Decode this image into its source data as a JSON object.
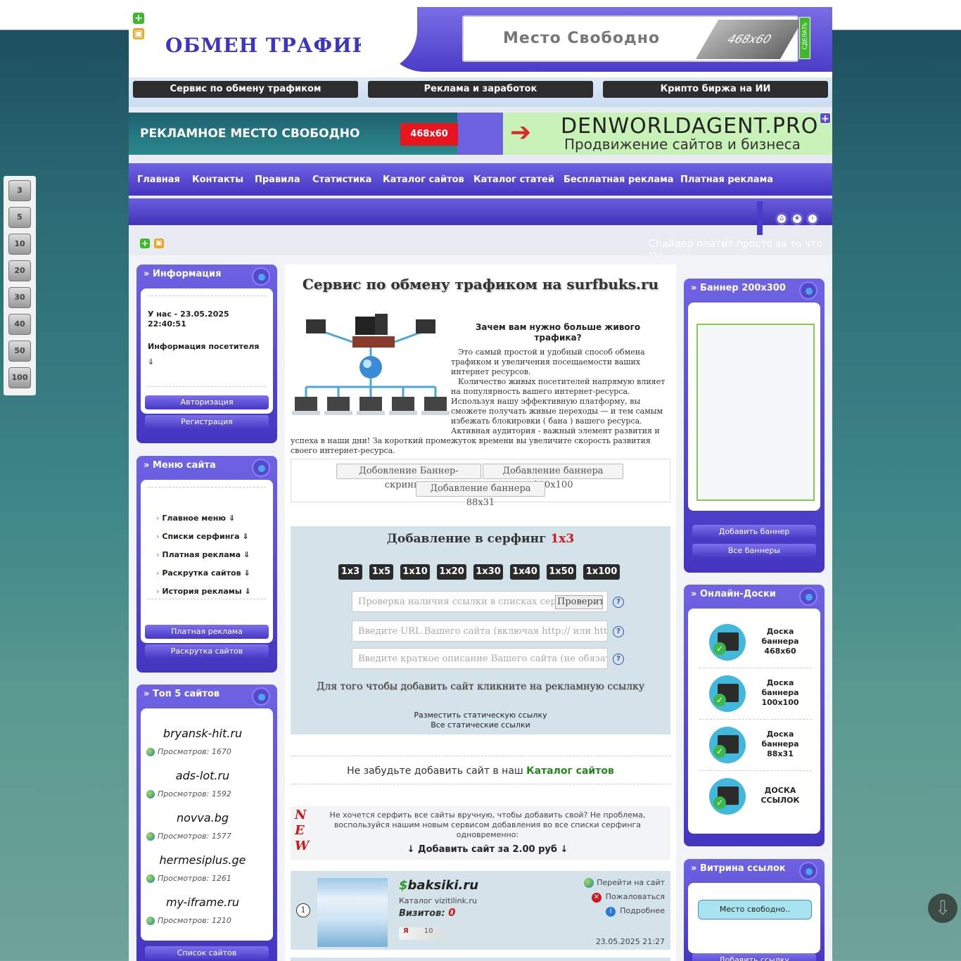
{
  "header": {
    "logo": "ОБМЕН ТРАФИКОМ",
    "top_banner_text": "Место  Свободно",
    "top_banner_size": "468x60",
    "side_tag": "СДЕЛАТЬ"
  },
  "nav_buttons": [
    "Сервис по обмену трафиком",
    "Реклама и заработок",
    "Крипто биржа на ИИ"
  ],
  "ad1": {
    "text": "РЕКЛАМНОЕ  МЕСТО СВОБОДНО",
    "size": "468x60"
  },
  "ad2": {
    "arrow": "➔",
    "domain": "DENWORLDAGENT.PRO",
    "tagline": "Продвижение сайтов и бизнеса"
  },
  "main_menu": [
    "Главная",
    "Контакты",
    "Правила",
    "Статистика",
    "Каталог сайтов",
    "Каталог статей",
    "Бесплатная реклама",
    "Платная реклама"
  ],
  "ticker": "Спайдер платит просто за то что ты",
  "sizes": [
    "3",
    "5",
    "10",
    "20",
    "30",
    "40",
    "50",
    "100"
  ],
  "info": {
    "title": "Информация",
    "date": "У нас - 23.05.2025",
    "time": "22:40:51",
    "visitor": "Информация посетителя",
    "arrow": "⇓",
    "auth": "Авторизация",
    "reg": "Регистрация"
  },
  "menu": {
    "title": "Меню сайта",
    "items": [
      "Главное меню ⇓",
      "Списки серфинга ⇓",
      "Платная реклама ⇓",
      "Раскрутка сайтов ⇓",
      "История рекламы ⇓"
    ],
    "btn1": "Платная реклама",
    "btn2": "Раскрутка сайтов"
  },
  "top5": {
    "title": "Топ 5 сайтов",
    "sites": [
      {
        "name": "bryansk-hit.ru",
        "views": "Просмотров: 1670"
      },
      {
        "name": "ads-lot.ru",
        "views": "Просмотров: 1592"
      },
      {
        "name": "novva.bg",
        "views": "Просмотров: 1577"
      },
      {
        "name": "hermesiplus.ge",
        "views": "Просмотров: 1261"
      },
      {
        "name": "my-iframe.ru",
        "views": "Просмотров: 1210"
      }
    ],
    "btn": "Список сайтов"
  },
  "center": {
    "title": "Сервис по обмену трафиком на surfbuks.ru",
    "why": "Зачем вам нужно больше живого трафика?",
    "p1": "Это самый простой и удобный способ обмена трафиком и увеличения посещаемости ваших интернет ресурсов.",
    "p2": "Количество живых посетителей напрямую влияет на популярность вашего интернет-ресурса. Используя нашу эффективную платформу, вы сможете получать живые переходы — и тем самым избежать блокировки ( бана ) вашего ресурса.",
    "p3": "Активная аудитория - важный элемент развития и",
    "p4": "успеха в наши дни! За короткий промежуток времени вы увеличите скорость развития своего интернет-ресурса.",
    "tab1": "Добовление Баннер-скриншот",
    "tab2": "Добавление баннера 100x100",
    "tab3": "Добавление баннера 88x31"
  },
  "surf": {
    "title_prefix": "Добавление в серфинг",
    "title_suffix": "1x3",
    "buttons": [
      "1x3",
      "1x5",
      "1x10",
      "1x20",
      "1x30",
      "1x40",
      "1x50",
      "1x100"
    ],
    "check_placeholder": "Проверка наличия ссылки в списках серфинга",
    "check_btn": "Проверить",
    "url_placeholder": "Введите URL Вашего сайта (включая http:// или https://)",
    "desc_placeholder": "Введите краткое описание Вашего сайта (не обязательно)",
    "help": "?",
    "hint": "Для того чтобы добавить сайт кликните на рекламную ссылку",
    "static1": "Разместить статическую ссылку",
    "static2": "Все статические ссылки"
  },
  "catalog": {
    "prefix": "Не забудьте добавить сайт в наш",
    "link": "Каталог сайтов"
  },
  "newbox": {
    "letters": [
      "N",
      "E",
      "W"
    ],
    "text": "Не хочется серфить все сайты вручную, чтобы добавить свой? Не проблема, воспользуйся нашим новым сервисом добавления во все списки серфинга одновременно:",
    "cta": "↓ Добавить сайт за 2.00 руб ↓"
  },
  "listing": {
    "rank": "1",
    "dollar": "$",
    "site": "baksiki.ru",
    "sub": "Каталог vizitilink.ru",
    "visits_label": "Визитов:",
    "visits": "0",
    "ya": "Я",
    "ya_val": "10",
    "go": "Перейти на сайт",
    "report": "Пожаловаться",
    "more": "Подробнее",
    "date": "23.05.2025 21:27"
  },
  "right": {
    "ban_title": "Баннер 200x300",
    "add_ban": "Добавить баннер",
    "all_ban": "Все баннеры",
    "boards_title": "Онлайн-Доски",
    "boards": [
      "Доска баннера 468x60",
      "Доска баннера 100x100",
      "Доска баннера 88x31",
      "ДОСКА ССЫЛОК"
    ],
    "vitr_title": "Витрина ссылок",
    "vitr_free": "Место свободно..",
    "vitr_add": "Добавить ссылку"
  },
  "colors": {
    "accent": "#4b3cc8",
    "surf_bg": "#d4e2ea",
    "green": "#228818"
  }
}
